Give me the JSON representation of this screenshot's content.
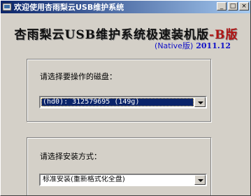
{
  "window": {
    "title": "欢迎使用杏雨梨云USB维护系统",
    "minimize_glyph": "_",
    "maximize_glyph": "□",
    "close_glyph": "×"
  },
  "banner": {
    "title_main": "杏雨梨云USB维护系统极速装机版",
    "title_accent": "-B版",
    "edition": "(Native版)",
    "date": "2011.12"
  },
  "disk_group": {
    "label": "请选择要操作的磁盘：",
    "selected_value": "(hd0): 312579695 (149g)"
  },
  "install_group": {
    "label": "请选择安装方式：",
    "selected_value": "标准安装(重新格式化全盘)"
  },
  "colors": {
    "titlebar_start": "#0a246a",
    "titlebar_end": "#a6caf0",
    "face": "#d4d0c8",
    "accent_red": "#b01515",
    "accent_blue": "#1010c8"
  },
  "icons": {
    "app": "app-icon",
    "dropdown": "chevron-down-icon"
  }
}
